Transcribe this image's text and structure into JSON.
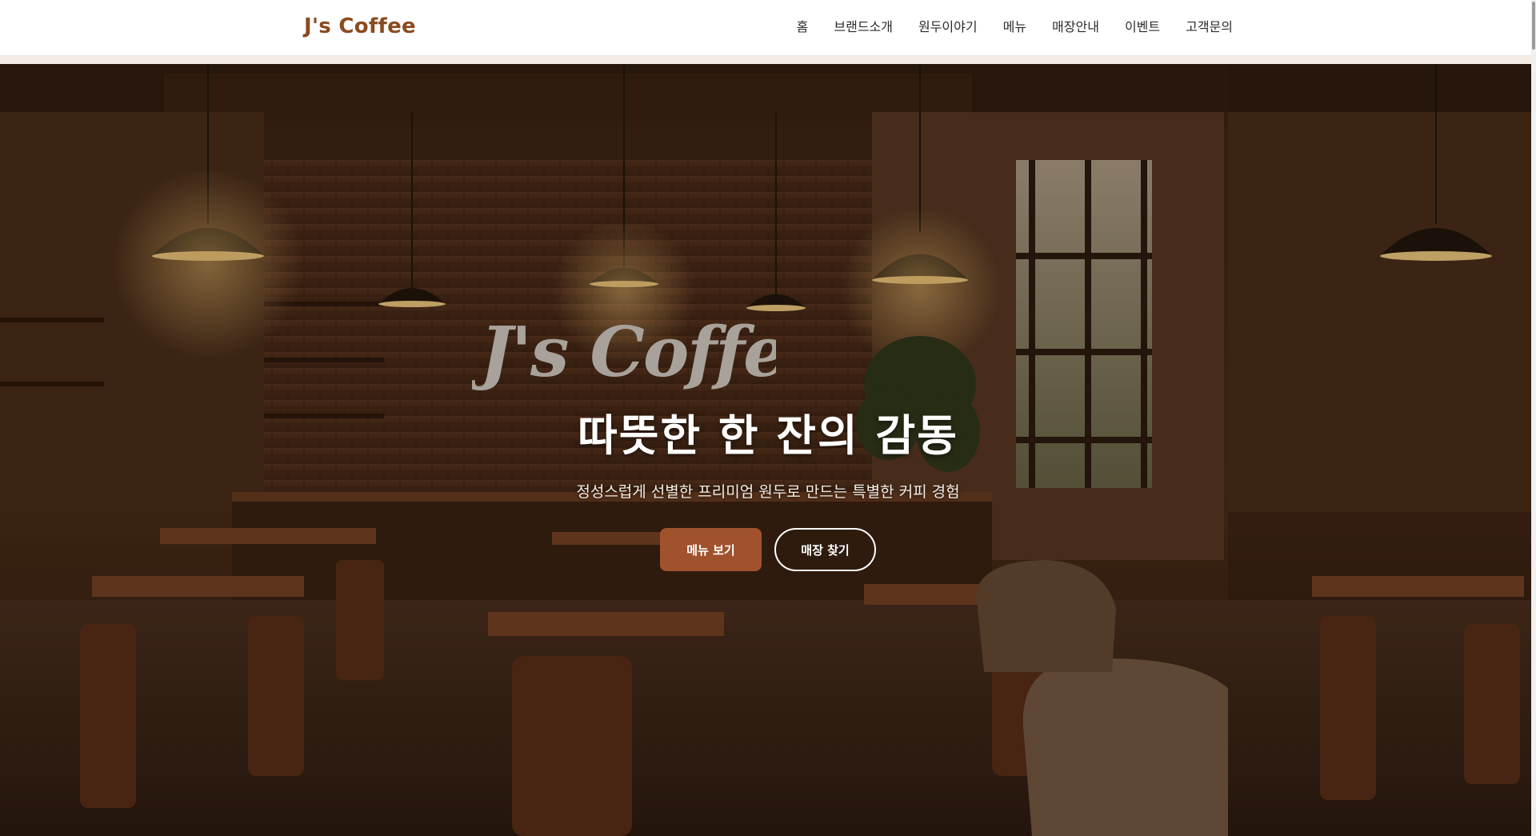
{
  "header": {
    "logo": "J's Coffee",
    "nav": [
      "홈",
      "브랜드소개",
      "원두이야기",
      "메뉴",
      "매장안내",
      "이벤트",
      "고객문의"
    ]
  },
  "hero": {
    "sign_text": "J's Coffee",
    "title": "따뜻한 한 잔의 감동",
    "subtitle": "정성스럽게 선별한 프리미엄 원두로 만드는 특별한 커피 경험",
    "primary_button": "메뉴 보기",
    "secondary_button": "매장 찾기"
  },
  "colors": {
    "brand": "#8b4a1f",
    "primary_button": "#a0522d",
    "hero_dark": "#2a1a10"
  }
}
